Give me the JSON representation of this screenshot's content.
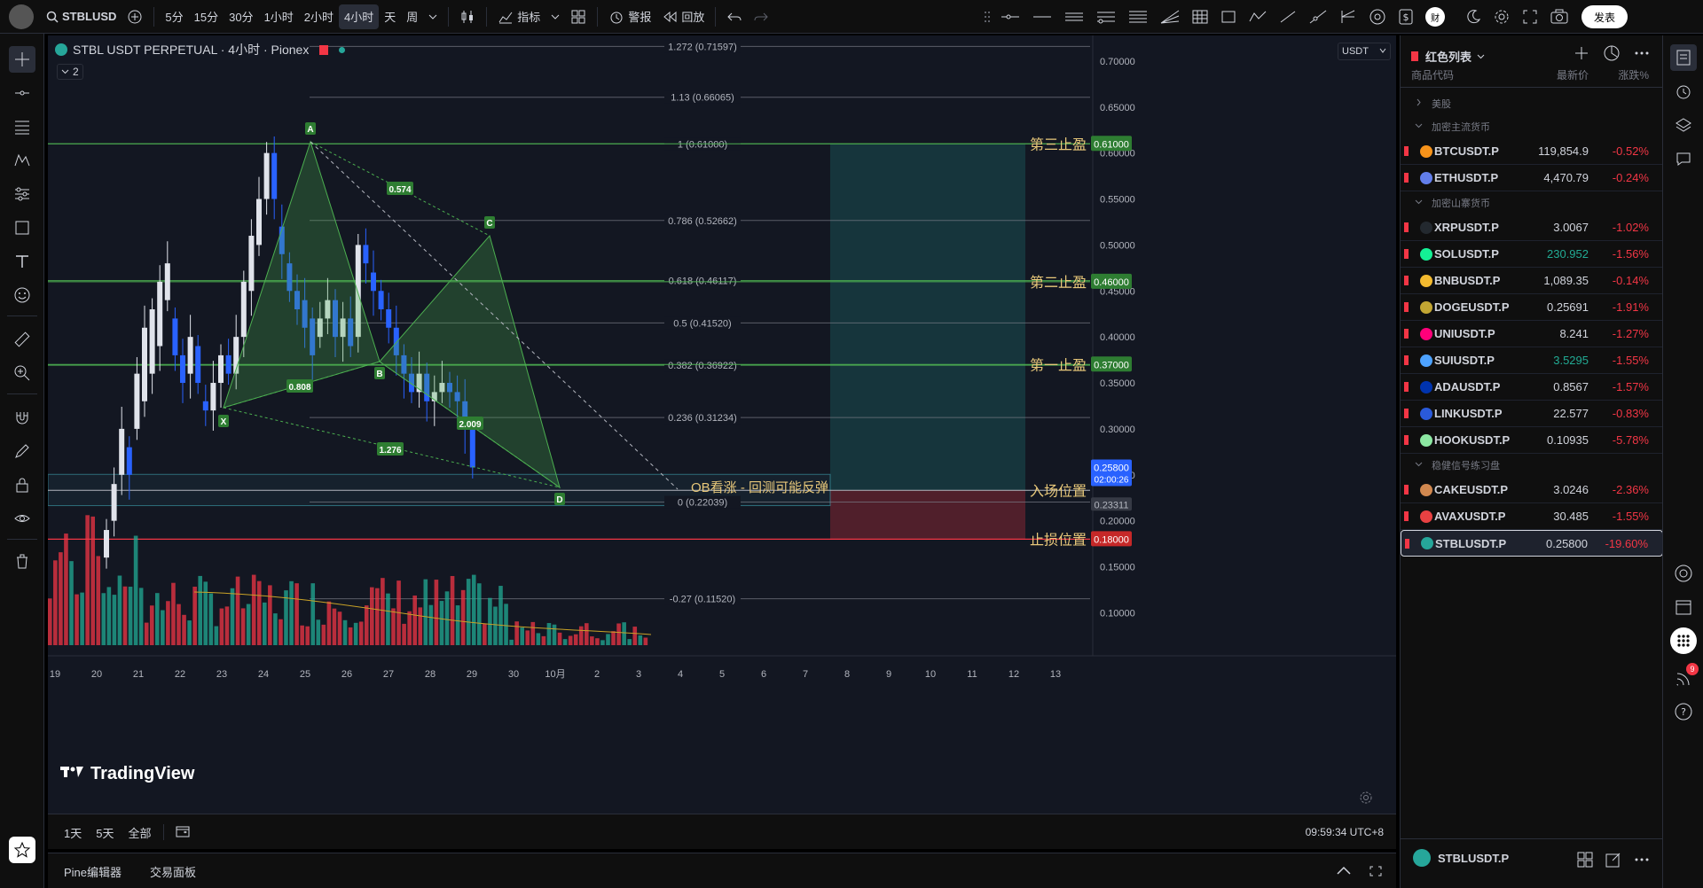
{
  "toolbar": {
    "symbol": "STBLUSD",
    "timeframes": [
      "5分",
      "15分",
      "30分",
      "1小时",
      "2小时",
      "4小时",
      "天",
      "周"
    ],
    "active_timeframe": "4小时",
    "indicators_label": "指标",
    "alert_label": "警报",
    "replay_label": "回放",
    "publish_label": "发表",
    "avatar_letter": "财"
  },
  "legend": {
    "title": "STBL USDT PERPETUAL · 4小时 · Pionex",
    "collapse_count": "2"
  },
  "currency_selector": "USDT",
  "price_axis": [
    "0.70000",
    "0.65000",
    "0.60000",
    "0.55000",
    "0.50000",
    "0.45000",
    "0.40000",
    "0.35000",
    "0.30000",
    "0.25000",
    "0.20000",
    "0.15000",
    "0.10000"
  ],
  "time_axis": [
    "19",
    "20",
    "21",
    "22",
    "23",
    "24",
    "25",
    "26",
    "27",
    "28",
    "29",
    "30",
    "10月",
    "2",
    "3",
    "4",
    "5",
    "6",
    "7",
    "8",
    "9",
    "10",
    "11",
    "12",
    "13"
  ],
  "fib_levels": [
    {
      "label": "1.272 (0.71597)"
    },
    {
      "label": "1.13 (0.66065)"
    },
    {
      "label": "1 (0.61000)"
    },
    {
      "label": "0.786 (0.52662)"
    },
    {
      "label": "0.618 (0.46117)"
    },
    {
      "label": "0.5 (0.41520)"
    },
    {
      "label": "0.382 (0.36922)"
    },
    {
      "label": "0.236 (0.31234)"
    },
    {
      "label": "0 (0.22039)"
    },
    {
      "label": "-0.27 (0.11520)"
    }
  ],
  "pattern": {
    "points": [
      "X",
      "A",
      "B",
      "C",
      "D"
    ],
    "ratios": [
      "0.574",
      "0.808",
      "2.009",
      "1.276"
    ]
  },
  "annotations": {
    "tp3": "第三止盈",
    "tp2": "第二止盈",
    "tp1": "第一止盈",
    "entry": "入场位置",
    "stop": "止损位置",
    "ob_note": "OB看涨 - 回测可能反弹"
  },
  "price_tags": {
    "tp3": "0.61000",
    "tp2": "0.46000",
    "tp1": "0.37000",
    "current": "0.25800",
    "countdown": "02:00:26",
    "entry": "0.23311",
    "stop": "0.18000"
  },
  "watermark": "TradingView",
  "bottom": {
    "ranges": [
      "1天",
      "5天",
      "全部"
    ],
    "clock": "09:59:34 UTC+8"
  },
  "footer": {
    "tabs": [
      "Pine编辑器",
      "交易面板"
    ]
  },
  "watchlist": {
    "title": "红色列表",
    "col_symbol": "商品代码",
    "col_price": "最新价",
    "col_change": "涨跌%",
    "groups": [
      {
        "name": "美股",
        "items": []
      },
      {
        "name": "加密主流货币",
        "items": [
          {
            "symbol": "BTCUSDT.P",
            "price": "119,854.9",
            "change": "-0.52%",
            "price_color": "#d1d4dc"
          },
          {
            "symbol": "ETHUSDT.P",
            "price": "4,470.79",
            "change": "-0.24%",
            "price_color": "#d1d4dc"
          }
        ]
      },
      {
        "name": "加密山寨货币",
        "items": [
          {
            "symbol": "XRPUSDT.P",
            "price": "3.0067",
            "change": "-1.02%",
            "price_color": "#d1d4dc"
          },
          {
            "symbol": "SOLUSDT.P",
            "price": "230.952",
            "change": "-1.56%",
            "price_color": "#22ab94"
          },
          {
            "symbol": "BNBUSDT.P",
            "price": "1,089.35",
            "change": "-0.14%",
            "price_color": "#d1d4dc"
          },
          {
            "symbol": "DOGEUSDT.P",
            "price": "0.25691",
            "change": "-1.91%",
            "price_color": "#d1d4dc"
          },
          {
            "symbol": "UNIUSDT.P",
            "price": "8.241",
            "change": "-1.27%",
            "price_color": "#d1d4dc"
          },
          {
            "symbol": "SUIUSDT.P",
            "price": "3.5295",
            "change": "-1.55%",
            "price_color": "#22ab94"
          },
          {
            "symbol": "ADAUSDT.P",
            "price": "0.8567",
            "change": "-1.57%",
            "price_color": "#d1d4dc"
          },
          {
            "symbol": "LINKUSDT.P",
            "price": "22.577",
            "change": "-0.83%",
            "price_color": "#d1d4dc"
          },
          {
            "symbol": "HOOKUSDT.P",
            "price": "0.10935",
            "change": "-5.78%",
            "price_color": "#d1d4dc"
          }
        ]
      },
      {
        "name": "稳健信号练习盘",
        "items": [
          {
            "symbol": "CAKEUSDT.P",
            "price": "3.0246",
            "change": "-2.36%",
            "price_color": "#d1d4dc"
          },
          {
            "symbol": "AVAXUSDT.P",
            "price": "30.485",
            "change": "-1.55%",
            "price_color": "#d1d4dc"
          },
          {
            "symbol": "STBLUSDT.P",
            "price": "0.25800",
            "change": "-19.60%",
            "price_color": "#d1d4dc"
          }
        ]
      }
    ],
    "selected_symbol": "STBLUSDT.P",
    "badge_count": "9"
  },
  "colors": {
    "up": "#e0e3eb",
    "down": "#2962ff",
    "vol_up": "#22ab94",
    "vol_down": "#f23645",
    "tp": "#4caf50",
    "stop": "#f23645",
    "label": "#e8c87a"
  }
}
